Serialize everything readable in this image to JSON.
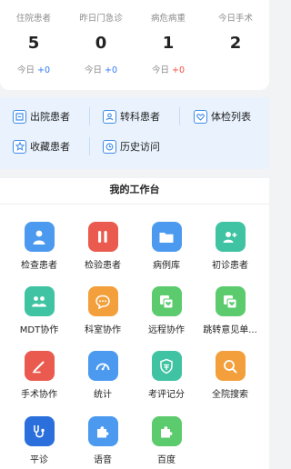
{
  "stats": [
    {
      "label": "住院患者",
      "value": "5",
      "today_label": "今日",
      "delta": "+0",
      "delta_color": "#2f7bf5"
    },
    {
      "label": "昨日门急诊",
      "value": "0",
      "today_label": "今日",
      "delta": "+0",
      "delta_color": "#2f7bf5"
    },
    {
      "label": "病危病重",
      "value": "1",
      "today_label": "今日",
      "delta": "+0",
      "delta_color": "#f5503d"
    },
    {
      "label": "今日手术",
      "value": "2"
    }
  ],
  "quick_links": [
    {
      "label": "出院患者",
      "icon": "discharge-icon"
    },
    {
      "label": "转科患者",
      "icon": "transfer-icon"
    },
    {
      "label": "体检列表",
      "icon": "checkup-icon"
    },
    {
      "label": "收藏患者",
      "icon": "star-icon"
    },
    {
      "label": "历史访问",
      "icon": "history-icon"
    }
  ],
  "workbench": {
    "title": "我的工作台",
    "tiles": [
      {
        "label": "检查患者",
        "color": "#4c9af0"
      },
      {
        "label": "检验患者",
        "color": "#ea5a4e"
      },
      {
        "label": "病例库",
        "color": "#4c9af0"
      },
      {
        "label": "初诊患者",
        "color": "#3fc3a2"
      },
      {
        "label": "MDT协作",
        "color": "#3fc3a2"
      },
      {
        "label": "科室协作",
        "color": "#f3a03c"
      },
      {
        "label": "远程协作",
        "color": "#5ccb6e"
      },
      {
        "label": "跳转意见单...",
        "color": "#5ccb6e"
      },
      {
        "label": "手术协作",
        "color": "#ea5a4e"
      },
      {
        "label": "统计",
        "color": "#4c9af0"
      },
      {
        "label": "考评记分",
        "color": "#3fc3a2"
      },
      {
        "label": "全院搜索",
        "color": "#f3a03c"
      },
      {
        "label": "平诊",
        "color": "#2a6fdc"
      },
      {
        "label": "语音",
        "color": "#4c9af0"
      },
      {
        "label": "百度",
        "color": "#5ccb6e"
      }
    ]
  }
}
